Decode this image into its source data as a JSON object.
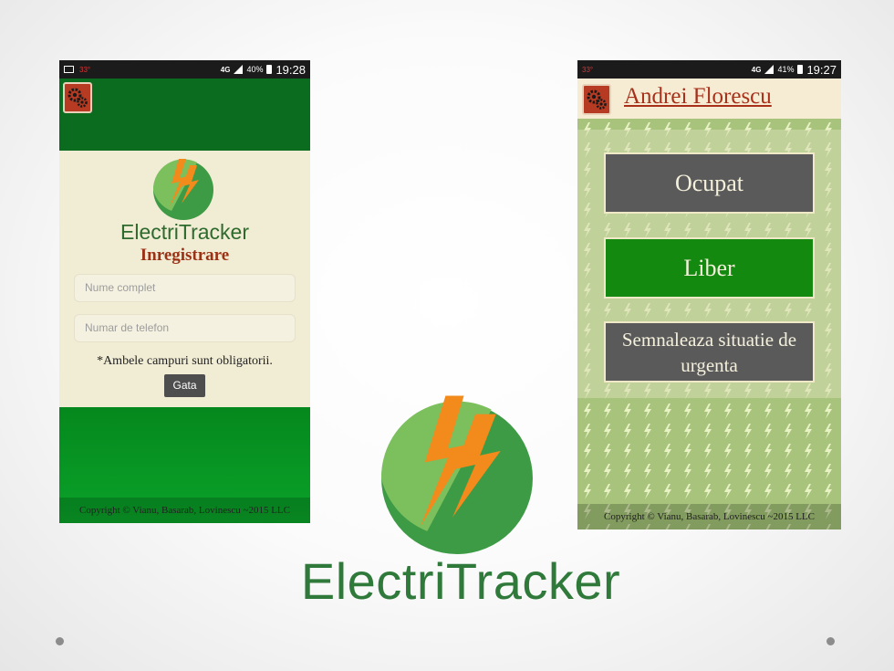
{
  "left_phone": {
    "status": {
      "temperature": "33°",
      "network": "4G",
      "battery_percent": "40%",
      "time": "19:28"
    },
    "icons": {
      "settings": "gear-icon"
    },
    "brand": "ElectriTracker",
    "form_title": "Inregistrare",
    "fields": {
      "name_placeholder": "Nume complet",
      "phone_placeholder": "Numar de telefon"
    },
    "required_note": "*Ambele campuri sunt obligatorii.",
    "submit_label": "Gata",
    "footer": "Copyright © Vianu, Basarab, Lovinescu ~2015 LLC"
  },
  "right_phone": {
    "status": {
      "temperature": "33°",
      "network": "4G",
      "battery_percent": "41%",
      "time": "19:27"
    },
    "username": "Andrei Florescu",
    "buttons": {
      "busy": "Ocupat",
      "free": "Liber",
      "emergency": "Semnaleaza situatie de urgenta"
    },
    "footer": "Copyright © Vianu, Basarab, Lovinescu ~2015 LLC"
  },
  "center_logo": {
    "brand": "ElectriTracker"
  },
  "colors": {
    "brand_green": "#2f7a3a",
    "orange": "#f28a1c",
    "header_green": "#0b6b1f",
    "accent_red": "#a8301a"
  }
}
